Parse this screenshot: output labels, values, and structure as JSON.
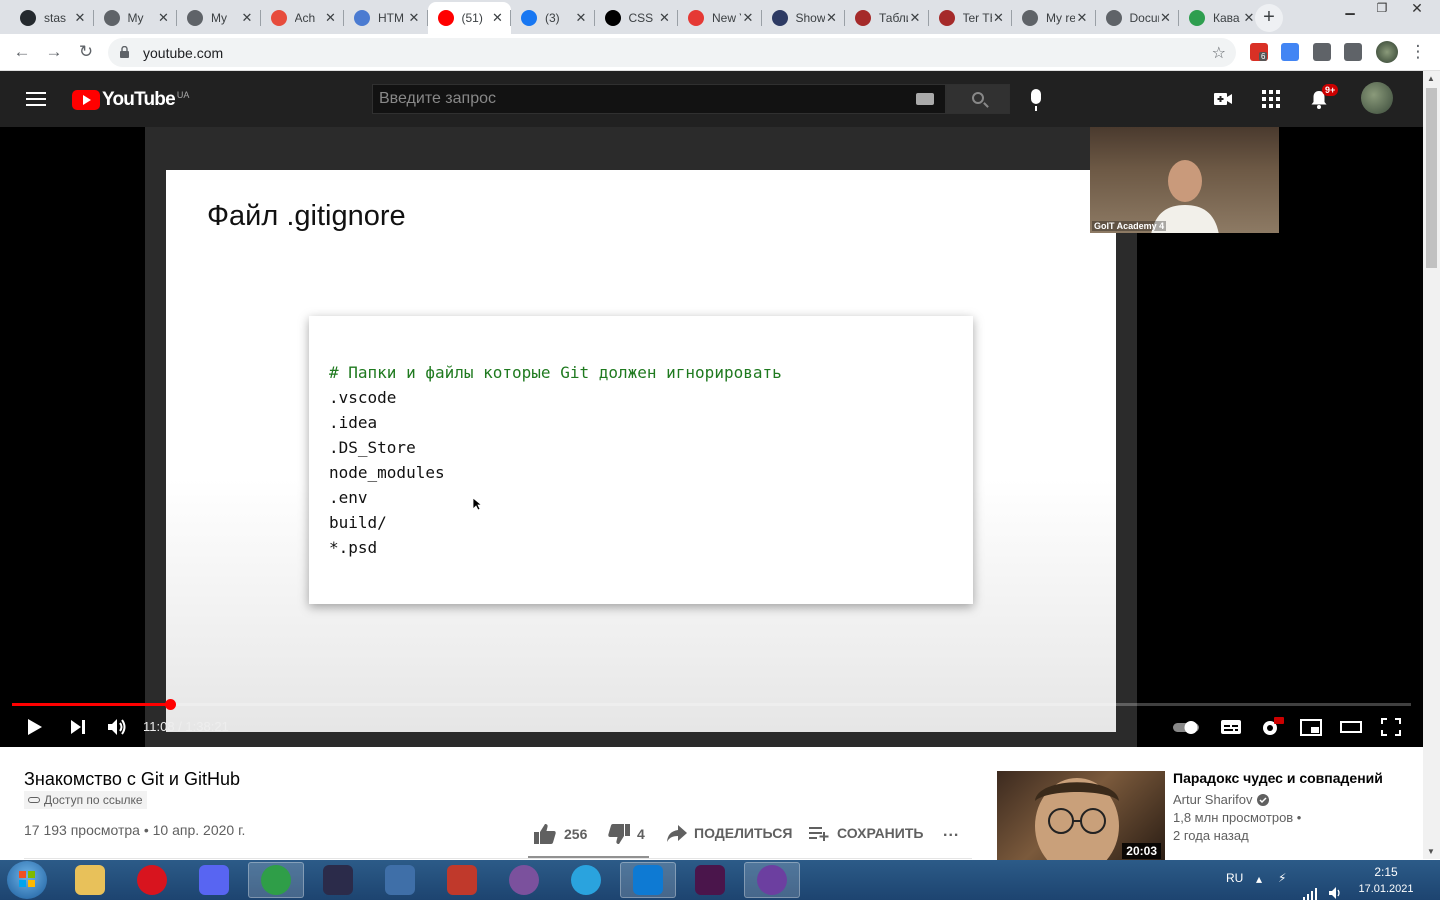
{
  "browser": {
    "tabs": [
      {
        "title": "stas",
        "favicon": "github-icon",
        "color": "#24292e"
      },
      {
        "title": "My",
        "favicon": "globe-icon",
        "color": "#5f6368"
      },
      {
        "title": "My",
        "favicon": "globe-icon",
        "color": "#5f6368"
      },
      {
        "title": "Ach",
        "favicon": "achievement-icon",
        "color": "#e74c3c"
      },
      {
        "title": "HTM",
        "favicon": "skype-icon",
        "color": "#4b7bd1"
      },
      {
        "title": "(51)",
        "favicon": "youtube-icon",
        "color": "#ff0000"
      },
      {
        "title": "(3)",
        "favicon": "facebook-icon",
        "color": "#1877f2"
      },
      {
        "title": "CSS",
        "favicon": "codepen-icon",
        "color": "#000000"
      },
      {
        "title": "New Ye",
        "favicon": "slides-icon",
        "color": "#e53935"
      },
      {
        "title": "Showinc",
        "favicon": "notion-icon",
        "color": "#2d3a63"
      },
      {
        "title": "Таблиц",
        "favicon": "sheet-icon",
        "color": "#a52a2a"
      },
      {
        "title": "Ter THE",
        "favicon": "sheet-icon",
        "color": "#a52a2a"
      },
      {
        "title": "My resu",
        "favicon": "globe-icon",
        "color": "#5f6368"
      },
      {
        "title": "Docume",
        "favicon": "globe-icon",
        "color": "#5f6368"
      },
      {
        "title": "Кава ар",
        "favicon": "leaf-icon",
        "color": "#2e9e4f"
      }
    ],
    "active_tab_index": 5,
    "url": "youtube.com",
    "extensions": [
      {
        "name": "adblock-icon",
        "color": "#d93025",
        "badge": "6"
      },
      {
        "name": "translate-icon",
        "color": "#4285f4",
        "badge": ""
      },
      {
        "name": "puzzle-icon",
        "color": "#5f6368",
        "badge": ""
      },
      {
        "name": "playlist-icon",
        "color": "#5f6368",
        "badge": ""
      }
    ]
  },
  "youtube": {
    "logo_text": "YouTube",
    "region": "UA",
    "search_placeholder": "Введите запрос",
    "notifications_badge": "9+"
  },
  "video": {
    "slide_title": "Файл .gitignore",
    "code_comment": "# Папки и файлы которые Git должен игнорировать",
    "code_lines": [
      ".vscode",
      ".idea",
      ".DS_Store",
      "node_modules",
      ".env",
      "build/",
      "*.psd"
    ],
    "pip_caption": "GoIT Academy 4",
    "time_current": "11:08",
    "time_total": "1:38:21",
    "progress_fraction": 0.113,
    "title": "Знакомство с Git и GitHub",
    "access_label": "Доступ по ссылке",
    "views": "17 193 просмотра",
    "date": "10 апр. 2020 г.",
    "likes": "256",
    "dislikes": "4",
    "share_label": "ПОДЕЛИТЬСЯ",
    "save_label": "СОХРАНИТЬ",
    "more_label": "..."
  },
  "recommendation": {
    "title": "Парадокс чудес и совпадений",
    "channel": "Artur Sharifov",
    "views": "1,8 млн просмотров •",
    "age": "2 года назад",
    "duration": "20:03"
  },
  "taskbar": {
    "apps": [
      {
        "name": "explorer-icon",
        "color": "#e8c15a"
      },
      {
        "name": "opera-icon",
        "color": "#d8141e"
      },
      {
        "name": "discord-icon",
        "color": "#5865f2"
      },
      {
        "name": "chrome-icon",
        "color": "#2f9e48"
      },
      {
        "name": "audition-icon",
        "color": "#2b2b4a"
      },
      {
        "name": "calculator-icon",
        "color": "#3f6fa8"
      },
      {
        "name": "git-app-icon",
        "color": "#c0392b"
      },
      {
        "name": "viber-icon",
        "color": "#7b519d"
      },
      {
        "name": "telegram-icon",
        "color": "#2aa3de"
      },
      {
        "name": "vscode-icon",
        "color": "#0e7ad3"
      },
      {
        "name": "slack-icon",
        "color": "#4a154b"
      },
      {
        "name": "kitty-icon",
        "color": "#6c3fa0"
      }
    ],
    "active_app_indices": [
      3,
      9,
      11
    ],
    "language": "RU",
    "time": "2:15",
    "date": "17.01.2021"
  }
}
